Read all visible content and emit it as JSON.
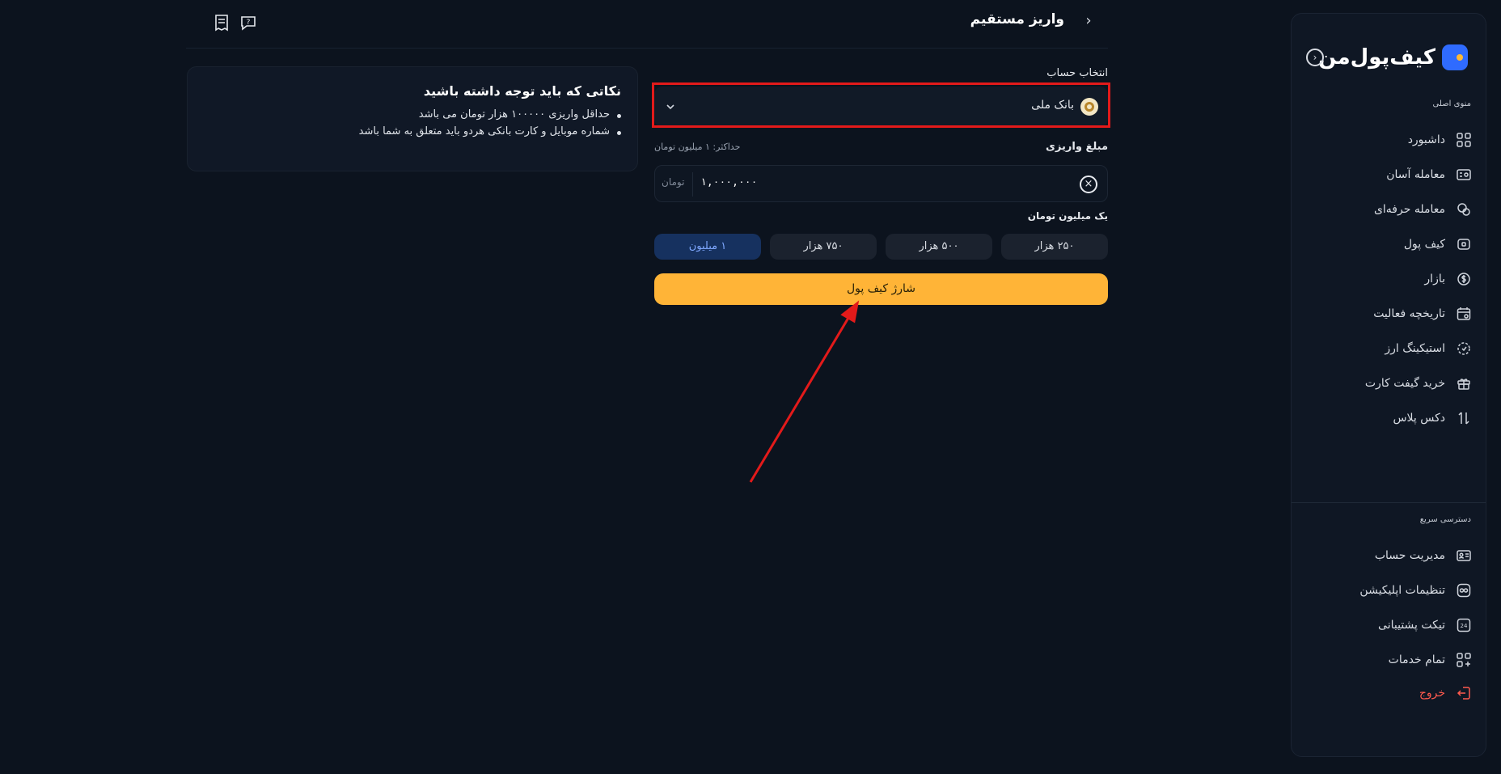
{
  "sidebar": {
    "logo_text": "کیف‌پول‌من",
    "main_menu_title": "منوی اصلی",
    "quick_access_title": "دسترسی سریع",
    "items": [
      {
        "label": "داشبورد",
        "icon": "grid-icon"
      },
      {
        "label": "معامله آسان",
        "icon": "wallet-card-icon"
      },
      {
        "label": "معامله حرفه‌ای",
        "icon": "coins-gear-icon"
      },
      {
        "label": "کیف پول",
        "icon": "wallet-icon"
      },
      {
        "label": "بازار",
        "icon": "dollar-coin-icon"
      },
      {
        "label": "تاریخچه فعالیت",
        "icon": "calendar-history-icon"
      },
      {
        "label": "استیکینگ ارز",
        "icon": "staking-icon"
      },
      {
        "label": "خرید گیفت کارت",
        "icon": "gift-icon"
      },
      {
        "label": "دکس پلاس",
        "icon": "dex-swap-icon"
      }
    ],
    "quick_items": [
      {
        "label": "مدیریت حساب",
        "icon": "id-card-icon"
      },
      {
        "label": "تنظیمات اپلیکیشن",
        "icon": "app-settings-icon"
      },
      {
        "label": "تیکت پشتیبانی",
        "icon": "support-24-icon"
      },
      {
        "label": "تمام خدمات",
        "icon": "all-services-icon"
      }
    ],
    "exit_label": "خروج"
  },
  "header": {
    "title": "واریز مستقیم"
  },
  "tips": {
    "title": "نکاتی که باید توجه داشته باشید",
    "items": [
      "حداقل واریزی ۱۰۰۰۰۰ هزار تومان می باشد",
      "شماره موبایل و کارت بانکی هردو باید متعلق به شما باشد"
    ]
  },
  "form": {
    "account_label": "انتخاب حساب",
    "selected_bank": "بانک ملی",
    "amount_label": "مبلغ واریزی",
    "max_note": "حداکثر: ۱ میلیون تومان",
    "amount_value": "۱,۰۰۰,۰۰۰",
    "unit": "تومان",
    "amount_words": "یک میلیون تومان",
    "presets": [
      "۲۵۰ هزار",
      "۵۰۰ هزار",
      "۷۵۰ هزار",
      "۱ میلیون"
    ],
    "active_preset": "۱ میلیون",
    "submit_label": "شارژ کیف پول"
  },
  "colors": {
    "background": "#0c131e",
    "accent": "#ffb437",
    "active_preset": "#16315f",
    "highlight": "#e31a1a",
    "exit": "#ff5a4e",
    "brand": "#2f6bff"
  }
}
